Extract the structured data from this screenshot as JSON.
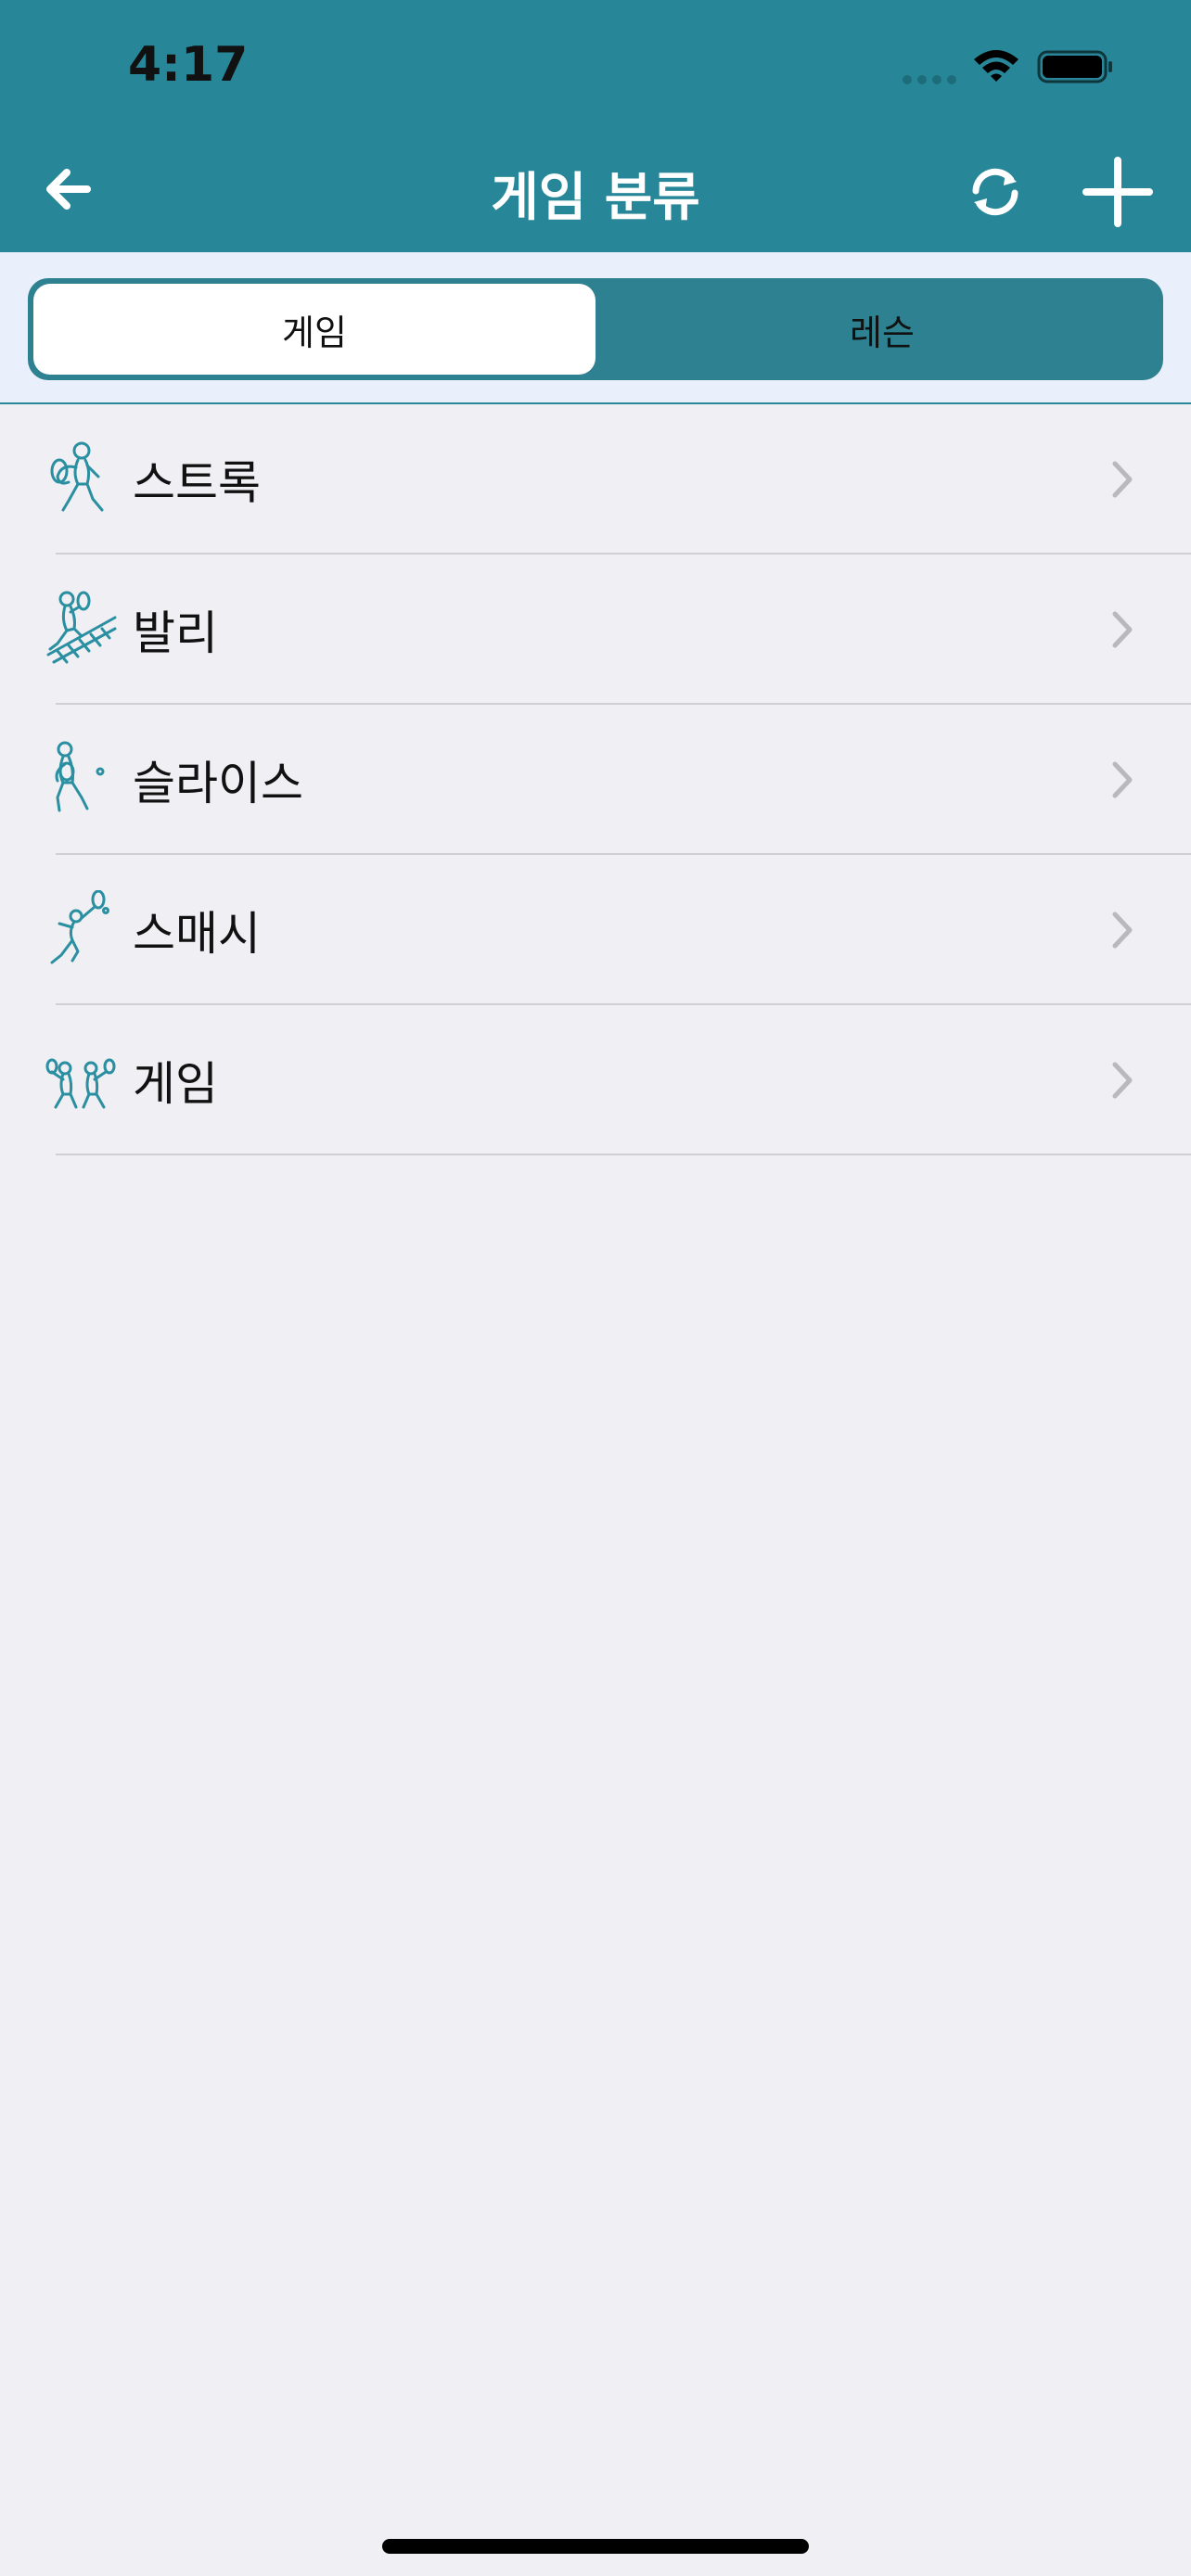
{
  "status_bar": {
    "time": "4:17",
    "signal_icon": "signal-dots-icon",
    "wifi_icon": "wifi-icon",
    "battery_icon": "battery-full-icon"
  },
  "nav": {
    "title": "게임 분류",
    "back_icon": "arrow-left-icon",
    "refresh_icon": "refresh-icon",
    "add_icon": "plus-icon"
  },
  "segments": [
    {
      "label": "게임",
      "selected": true
    },
    {
      "label": "레슨",
      "selected": false
    }
  ],
  "list": [
    {
      "label": "스트록",
      "icon": "tennis-stroke-icon"
    },
    {
      "label": "발리",
      "icon": "tennis-volley-icon"
    },
    {
      "label": "슬라이스",
      "icon": "tennis-slice-icon"
    },
    {
      "label": "스매시",
      "icon": "tennis-smash-icon"
    },
    {
      "label": "게임",
      "icon": "tennis-doubles-game-icon"
    }
  ],
  "colors": {
    "header": "#278798",
    "segment_bg": "#2d8190",
    "icon_stroke": "#2a8fa0",
    "background": "#efeff4"
  }
}
